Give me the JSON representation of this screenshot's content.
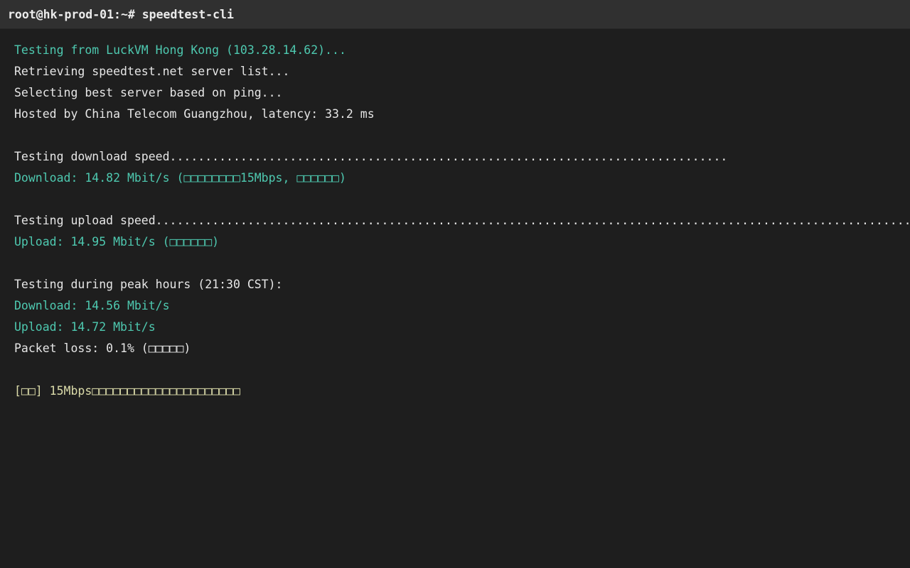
{
  "titlebar": {
    "prompt": "root@hk-prod-01:~# speedtest-cli"
  },
  "colors": {
    "background": "#1e1e1e",
    "titlebar": "#303030",
    "text": "#e6e6e6",
    "accent": "#4ec9b0",
    "warning": "#dcdcaa"
  },
  "output": [
    {
      "text": "Testing from LuckVM Hong Kong (103.28.14.62)...",
      "style": "accent"
    },
    {
      "text": "Retrieving speedtest.net server list...",
      "style": "default"
    },
    {
      "text": "Selecting best server based on ping...",
      "style": "default"
    },
    {
      "text": "Hosted by China Telecom Guangzhou, latency: 33.2 ms",
      "style": "default"
    },
    {
      "text": "",
      "style": "default"
    },
    {
      "text": "Testing download speed...............................................................................",
      "style": "default"
    },
    {
      "text": "Download: 14.82 Mbit/s (□□□□□□□□15Mbps, □□□□□□)",
      "style": "accent"
    },
    {
      "text": "",
      "style": "default"
    },
    {
      "text": "Testing upload speed.............................................................................................................",
      "style": "default"
    },
    {
      "text": "Upload: 14.95 Mbit/s (□□□□□□)",
      "style": "accent"
    },
    {
      "text": "",
      "style": "default"
    },
    {
      "text": "Testing during peak hours (21:30 CST):",
      "style": "default"
    },
    {
      "text": "Download: 14.56 Mbit/s",
      "style": "accent"
    },
    {
      "text": "Upload: 14.72 Mbit/s",
      "style": "accent"
    },
    {
      "text": "Packet loss: 0.1% (□□□□□)",
      "style": "default"
    },
    {
      "text": "",
      "style": "default"
    },
    {
      "text": "[□□] 15Mbps□□□□□□□□□□□□□□□□□□□□□",
      "style": "warn"
    }
  ]
}
